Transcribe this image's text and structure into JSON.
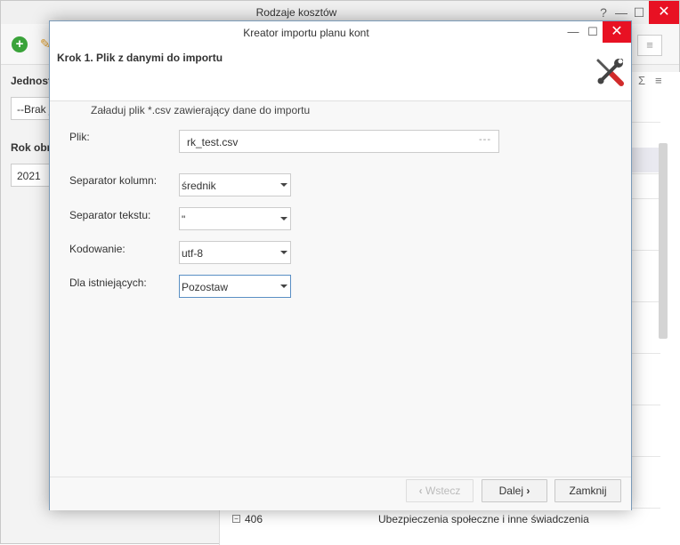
{
  "background_window": {
    "title": "Rodzaje kosztów",
    "help_glyph": "?",
    "minimize_glyph": "—",
    "maximize_glyph": "☐",
    "close_glyph": "✕",
    "add_glyph": "+",
    "menu_glyph": "≡",
    "sigma_glyph": "Σ",
    "left_panel": {
      "unit_label": "Jednost",
      "unit_value": "--Brak je",
      "year_label": "Rok obr",
      "year_value": "2021"
    },
    "grid_visible_row": {
      "code": "406",
      "name": "Ubezpieczenia społeczne i inne świadczenia"
    }
  },
  "dialog": {
    "title": "Kreator importu planu kont",
    "minimize_glyph": "—",
    "maximize_glyph": "☐",
    "close_glyph": "✕",
    "step_title": "Krok 1. Plik z danymi do importu",
    "icon": "tools-icon",
    "instruction": "Załaduj plik *.csv zawierający dane do importu",
    "fields": {
      "file": {
        "label": "Plik:",
        "value": "rk_test.csv",
        "browse": "---"
      },
      "column_separator": {
        "label": "Separator kolumn:",
        "value": "średnik"
      },
      "text_separator": {
        "label": "Separator tekstu:",
        "value": "\""
      },
      "encoding": {
        "label": "Kodowanie:",
        "value": "utf-8"
      },
      "existing": {
        "label": "Dla istniejących:",
        "value": "Pozostaw"
      }
    },
    "buttons": {
      "back": "Wstecz",
      "back_glyph": "‹",
      "next": "Dalej",
      "next_glyph": "›",
      "close": "Zamknij"
    }
  },
  "colors": {
    "close_red": "#e81123",
    "add_green": "#3aa33a",
    "focus_blue": "#5a8fc4"
  }
}
